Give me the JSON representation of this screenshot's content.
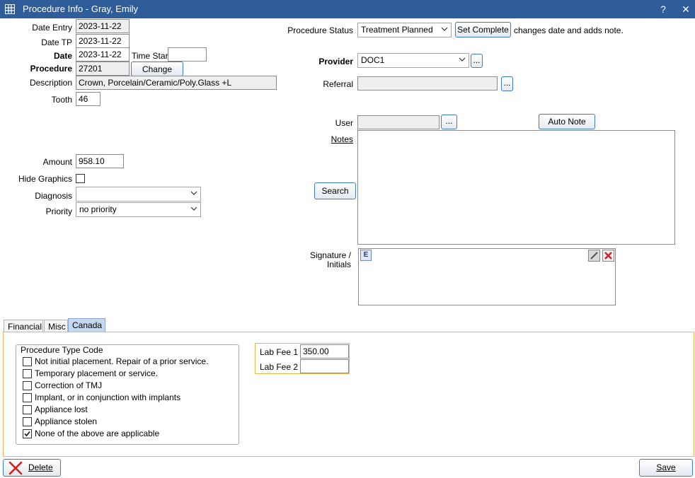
{
  "window": {
    "title": "Procedure Info - Gray, Emily",
    "help_glyph": "?",
    "close_glyph": "✕"
  },
  "left": {
    "date_entry_label": "Date Entry",
    "date_entry_value": "2023-11-22",
    "date_tp_label": "Date TP",
    "date_tp_value": "2023-11-22",
    "date_label": "Date",
    "date_value": "2023-11-22",
    "time_start_label": "Time Start",
    "time_start_value": "",
    "procedure_label": "Procedure",
    "procedure_value": "27201",
    "change_label": "Change",
    "description_label": "Description",
    "description_value": "Crown, Porcelain/Ceramic/Poly.Glass +L",
    "tooth_label": "Tooth",
    "tooth_value": "46",
    "amount_label": "Amount",
    "amount_value": "958.10",
    "hide_graphics_label": "Hide Graphics",
    "diagnosis_label": "Diagnosis",
    "diagnosis_value": "",
    "priority_label": "Priority",
    "priority_value": "no priority"
  },
  "right": {
    "status_label": "Procedure Status",
    "status_value": "Treatment Planned",
    "set_complete_label": "Set Complete",
    "set_complete_note": "changes date and adds note.",
    "provider_label": "Provider",
    "provider_value": "DOC1",
    "referral_label": "Referral",
    "referral_value": "",
    "ellipsis": "...",
    "user_label": "User",
    "user_value": "",
    "auto_note_label": "Auto Note",
    "notes_label": "Notes",
    "notes_value": "",
    "search_label": "Search",
    "signature_label_1": "Signature /",
    "signature_label_2": "Initials",
    "sig_e_glyph": "E"
  },
  "tabs": [
    {
      "label": "Financial"
    },
    {
      "label": "Misc"
    },
    {
      "label": "Canada"
    }
  ],
  "canada": {
    "group_title": "Procedure Type Code",
    "options": [
      {
        "label": "Not initial placement.  Repair of a prior service.",
        "checked": false
      },
      {
        "label": "Temporary placement or service.",
        "checked": false
      },
      {
        "label": "Correction of TMJ",
        "checked": false
      },
      {
        "label": "Implant, or in conjunction with implants",
        "checked": false
      },
      {
        "label": "Appliance lost",
        "checked": false
      },
      {
        "label": "Appliance stolen",
        "checked": false
      },
      {
        "label": "None of the above are applicable",
        "checked": true
      }
    ],
    "lab_fee_1_label": "Lab Fee 1",
    "lab_fee_1_value": "350.00",
    "lab_fee_2_label": "Lab Fee 2",
    "lab_fee_2_value": ""
  },
  "footer": {
    "delete_label": "Delete",
    "save_label": "Save"
  },
  "colors": {
    "titlebar": "#2f5d9a",
    "accent_border": "#f0b44c",
    "active_tab": "#c5d8f0"
  }
}
